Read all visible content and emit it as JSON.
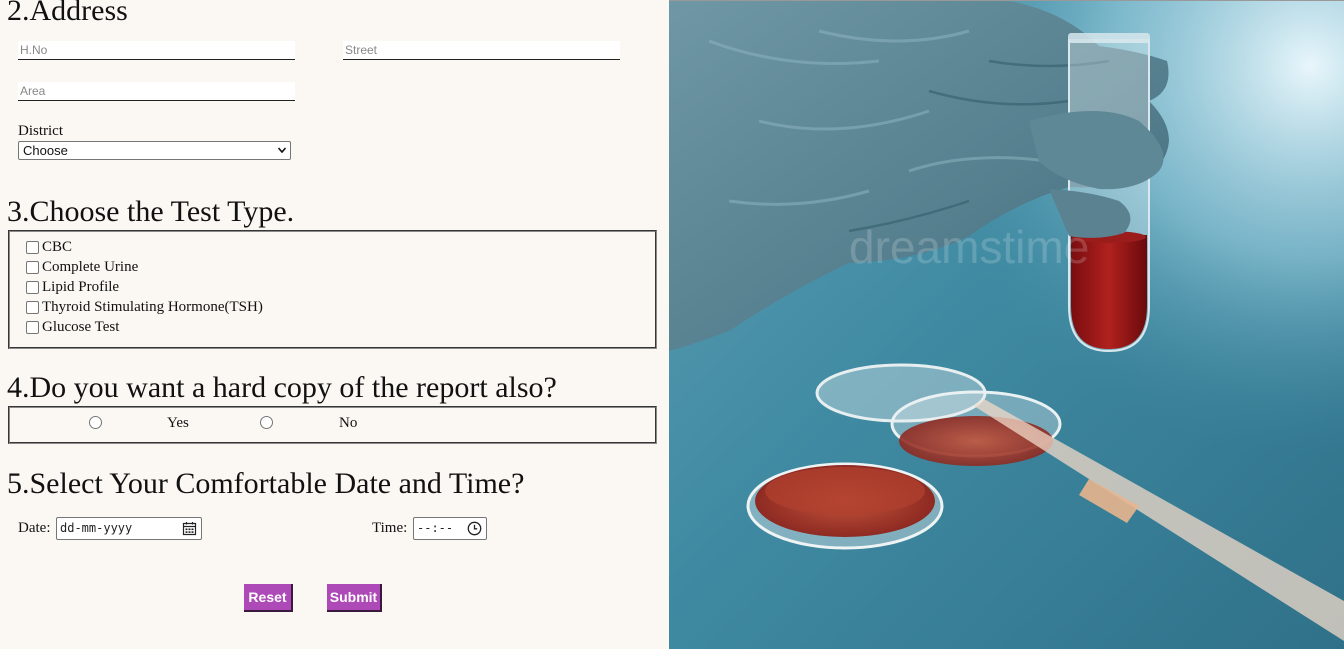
{
  "address": {
    "heading": "2.Address",
    "hno_placeholder": "H.No",
    "street_placeholder": "Street",
    "area_placeholder": "Area",
    "district_label": "District",
    "district_selected": "Choose"
  },
  "tests": {
    "heading": "3.Choose the Test Type.",
    "options": [
      "CBC",
      "Complete Urine",
      "Lipid Profile",
      "Thyroid Stimulating Hormone(TSH)",
      "Glucose Test"
    ]
  },
  "hardcopy": {
    "heading": "4.Do you want a hard copy of the report also?",
    "yes_label": "Yes",
    "no_label": "No"
  },
  "schedule": {
    "heading": "5.Select Your Comfortable Date and Time?",
    "date_label": "Date:",
    "date_value": "dd-mm-yyyy",
    "time_label": "Time:",
    "time_value": "--:--"
  },
  "actions": {
    "reset_label": "Reset",
    "submit_label": "Submit"
  },
  "photo": {
    "watermark": "dreamstime"
  },
  "colors": {
    "button_bg": "#ad4ab8",
    "page_bg": "#fbf8f3"
  }
}
